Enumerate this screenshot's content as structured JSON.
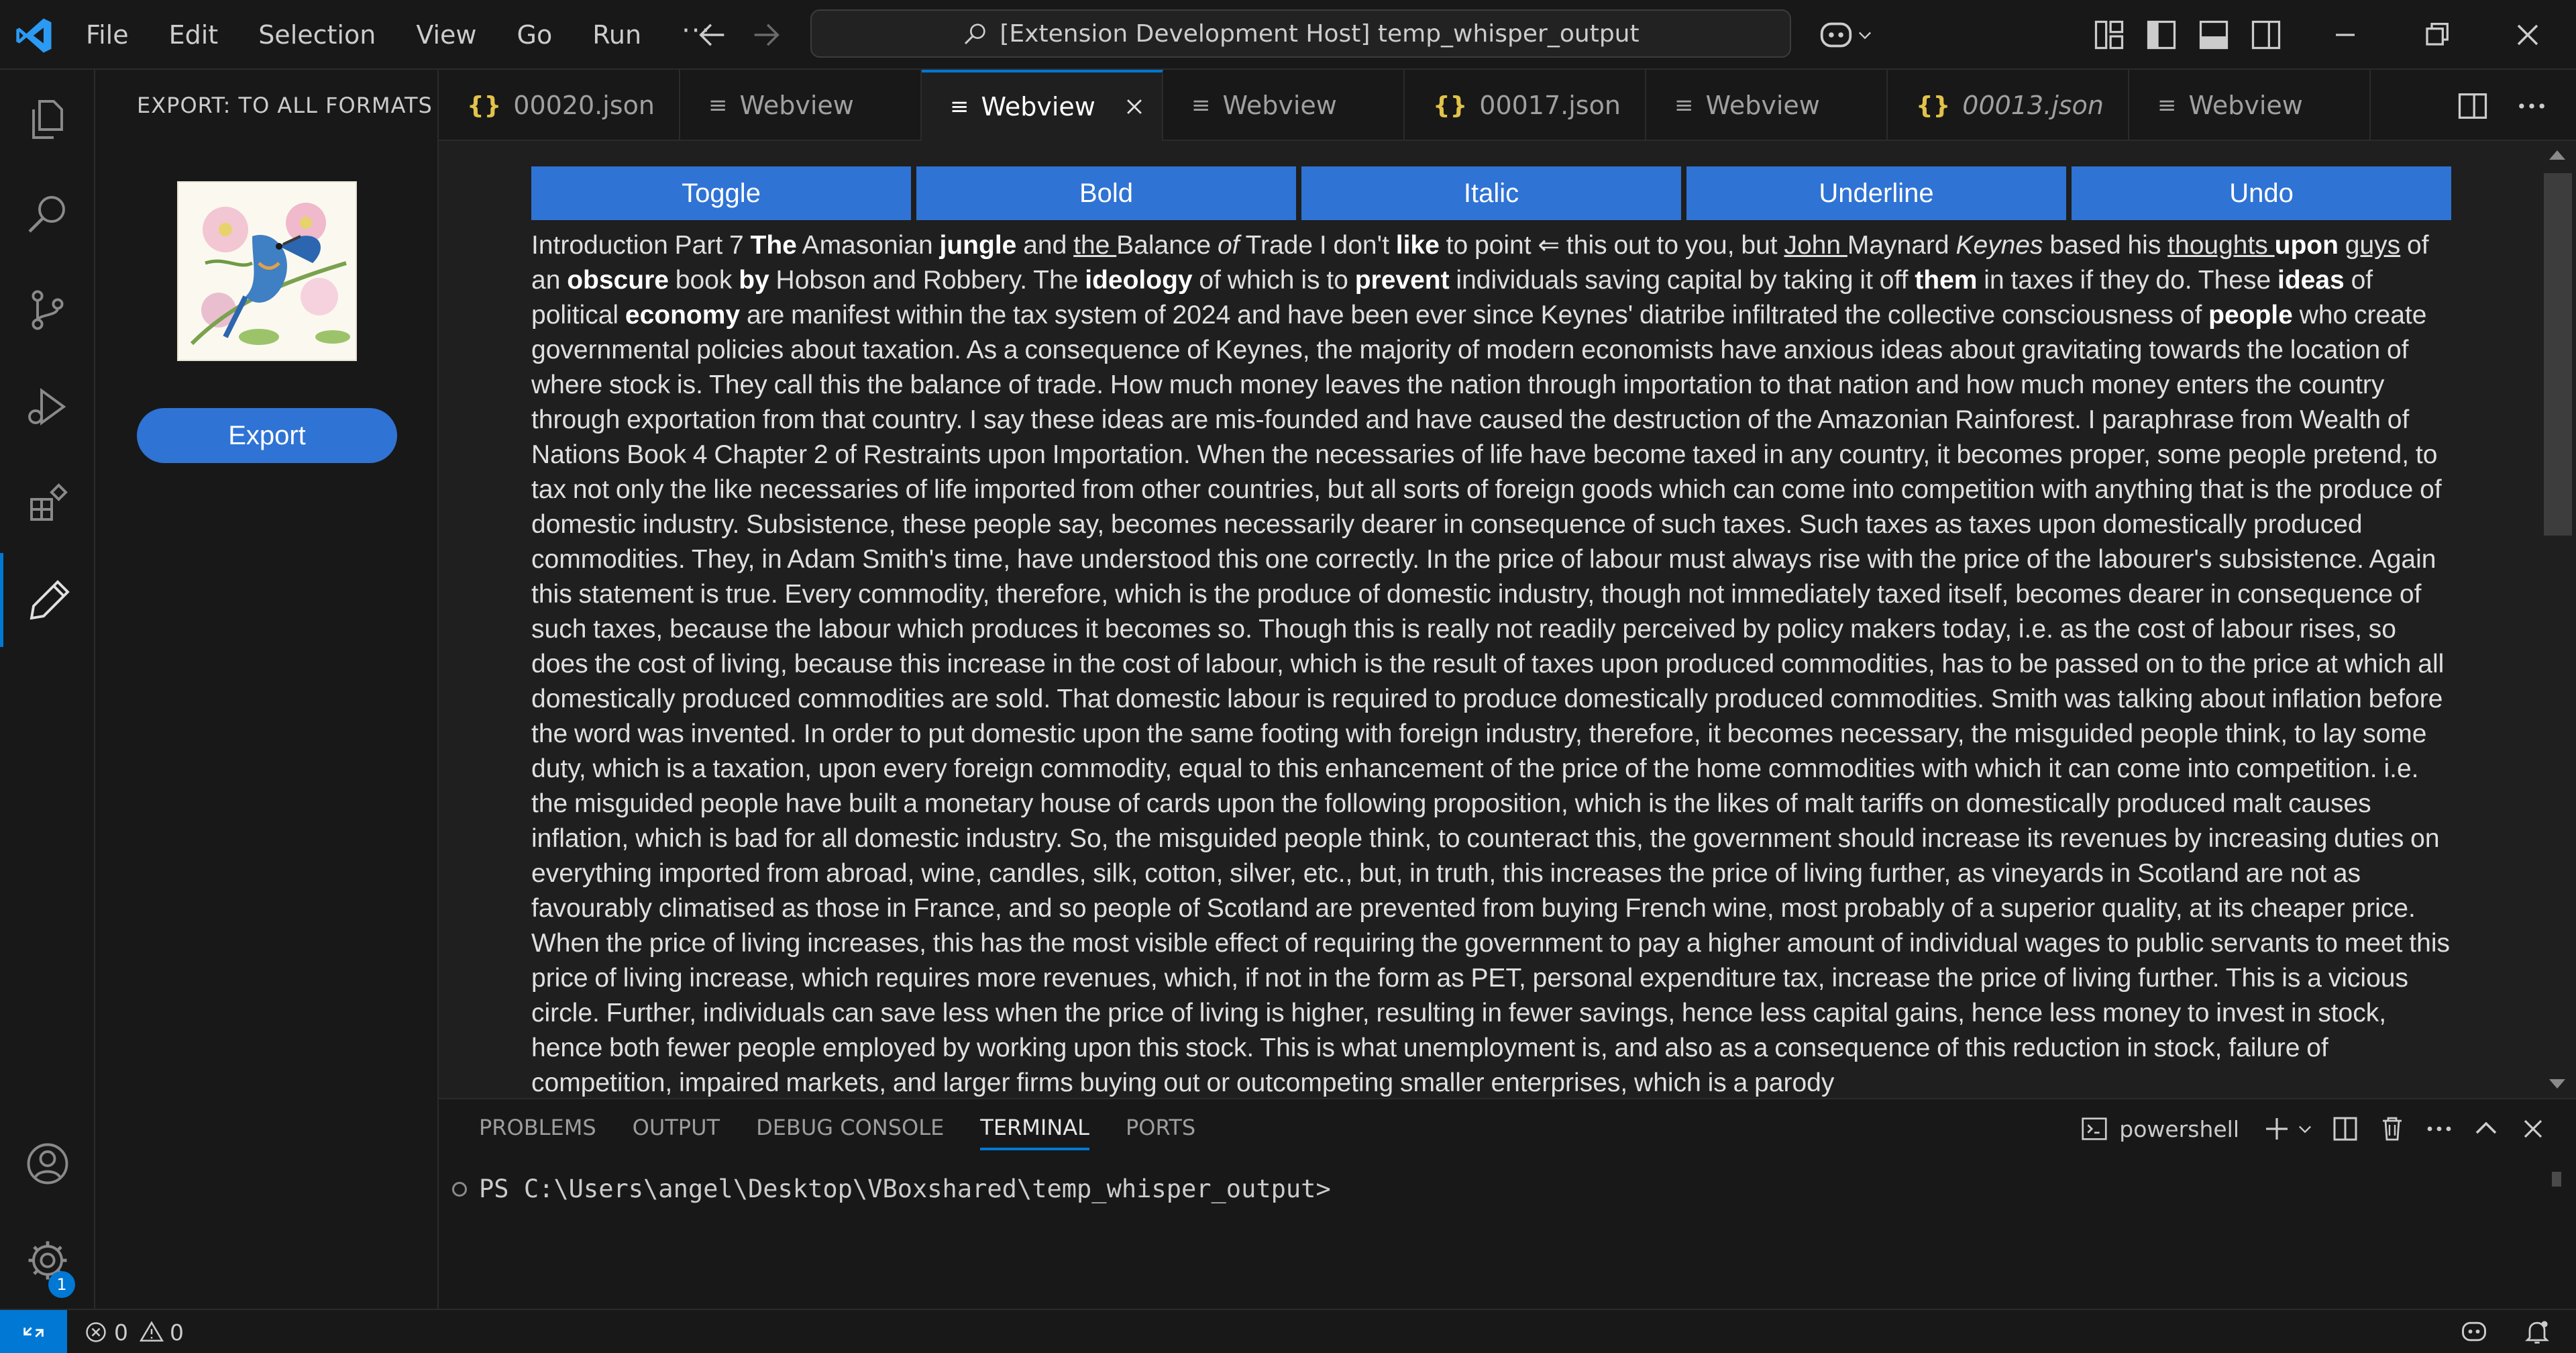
{
  "menu": [
    "File",
    "Edit",
    "Selection",
    "View",
    "Go",
    "Run",
    "···"
  ],
  "command_center": {
    "text": "[Extension Development Host] temp_whisper_output"
  },
  "sidebar": {
    "title": "EXPORT: TO ALL FORMATS",
    "export_button": "Export"
  },
  "tabs": [
    {
      "label": "00020.json",
      "type": "json",
      "active": false,
      "italic": false
    },
    {
      "label": "Webview",
      "type": "webview",
      "active": false,
      "italic": false
    },
    {
      "label": "Webview",
      "type": "webview",
      "active": true,
      "italic": false
    },
    {
      "label": "Webview",
      "type": "webview",
      "active": false,
      "italic": false
    },
    {
      "label": "00017.json",
      "type": "json",
      "active": false,
      "italic": false
    },
    {
      "label": "Webview",
      "type": "webview",
      "active": false,
      "italic": false
    },
    {
      "label": "00013.json",
      "type": "json",
      "active": false,
      "italic": true
    },
    {
      "label": "Webview",
      "type": "webview",
      "active": false,
      "italic": false
    }
  ],
  "toolbar": [
    "Toggle",
    "Bold",
    "Italic",
    "Underline",
    "Undo"
  ],
  "document": {
    "s01": "Introduction Part  7 ",
    "s02": "The",
    "s03": " Amasonian ",
    "s04": "jungle",
    "s05": " and ",
    "s06": "the ",
    "s07": "Balance ",
    "s08": "of",
    "s09": " Trade I don't ",
    "s10": "like",
    "s11": " to point ⇐ this out to you, but ",
    "s12": "John ",
    "s13": "Maynard ",
    "s14": "Keynes",
    "s15": " based his ",
    "s16": "thoughts ",
    "s17": "upon",
    "s18": " ",
    "s19": "guys",
    "s20": " of an ",
    "s21": "obscure",
    "s22": " book ",
    "s23": "by",
    "s24": " Hobson and Robbery.  The ",
    "s25": "ideology",
    "s26": " of which is to ",
    "s27": "prevent",
    "s28": " individuals saving capital by taking it off ",
    "s29": "them",
    "s30": " in taxes if they do. These ",
    "s31": "ideas",
    "s32": " of political ",
    "s33": "economy",
    "s34": " are manifest within the tax system of 2024 and have been ever since Keynes' diatribe infiltrated the collective consciousness of ",
    "s35": "people",
    "s36": " who create governmental policies about taxation. As a consequence of Keynes, the majority of modern economists have anxious ideas about gravitating towards the location of where stock is. They call this the balance of trade. How much money leaves the nation through importation to that nation and how much money enters the country through exportation from that country. I say these ideas are mis-founded and have caused the destruction of the Amazonian Rainforest. I paraphrase from Wealth of Nations Book 4 Chapter 2 of Restraints upon Importation. When the necessaries of life have become taxed in any country, it becomes proper, some people pretend, to tax not only the like necessaries of life imported from other countries, but all sorts of foreign goods which can come into competition with anything that is the produce of domestic industry. Subsistence, these people say, becomes necessarily dearer in consequence of such taxes. Such taxes as taxes upon domestically produced commodities. They, in Adam Smith's time, have understood this one correctly. In the price of labour must always rise with the price of the labourer's subsistence. Again this statement is true. Every commodity, therefore, which is the produce of domestic industry, though not immediately taxed itself, becomes dearer in consequence of such taxes, because the labour which produces it becomes so. Though this is really not readily perceived by policy makers today, i.e. as the cost of labour rises, so does the cost of living, because this increase in the cost of labour, which is the result of taxes upon produced commodities, has to be passed on to the price at which all domestically produced commodities are sold. That domestic labour is required to produce domestically produced commodities. Smith was talking about inflation before the word was invented. In order to put domestic upon the same footing with foreign industry, therefore, it becomes necessary, the misguided people think, to lay some duty, which is a taxation, upon every foreign commodity, equal to this enhancement of the price of the home commodities with which it can come into competition. i.e. the misguided people have built a monetary house of cards upon the following proposition, which is the likes of malt tariffs on domestically produced malt causes inflation, which is bad for all domestic industry. So, the misguided people think, to counteract this, the government should increase its revenues by increasing duties on everything imported from abroad, wine, candles, silk, cotton, silver, etc., but, in truth, this increases the price of living further, as vineyards in Scotland are not as favourably climatised as those in France, and so people of Scotland are prevented from buying French wine, most probably of a superior quality, at its cheaper price. When the price of living increases, this has the most visible effect of requiring the government to pay a higher amount of individual wages to public servants to meet this price of living increase, which requires more revenues, which, if not in the form as PET, personal expenditure tax, increase the price of living further. This is a vicious circle. Further, individuals can save less when the price of living is higher, resulting in fewer savings, hence less capital gains, hence less money to invest in stock, hence both fewer people employed by working upon this stock. This is what unemployment is, and also as a consequence of this reduction in stock, failure of competition, impaired markets, and larger firms buying out or outcompeting smaller enterprises, which is a parody"
  },
  "panel": {
    "tabs": [
      "PROBLEMS",
      "OUTPUT",
      "DEBUG CONSOLE",
      "TERMINAL",
      "PORTS"
    ],
    "active_tab": "TERMINAL",
    "shell": "powershell",
    "terminal_prompt": "PS C:\\Users\\angel\\Desktop\\VBoxshared\\temp_whisper_output>"
  },
  "status": {
    "errors": "0",
    "warnings": "0",
    "settings_badge": "1"
  },
  "icons": {
    "activity": [
      "explorer-icon",
      "search-icon",
      "source-control-icon",
      "run-debug-icon",
      "extensions-icon",
      "pencil-icon",
      "account-icon",
      "manage-gear-icon"
    ]
  },
  "colors": {
    "accent": "#0078d4",
    "button": "#2f73d4",
    "json_icon": "#e2c24a"
  }
}
